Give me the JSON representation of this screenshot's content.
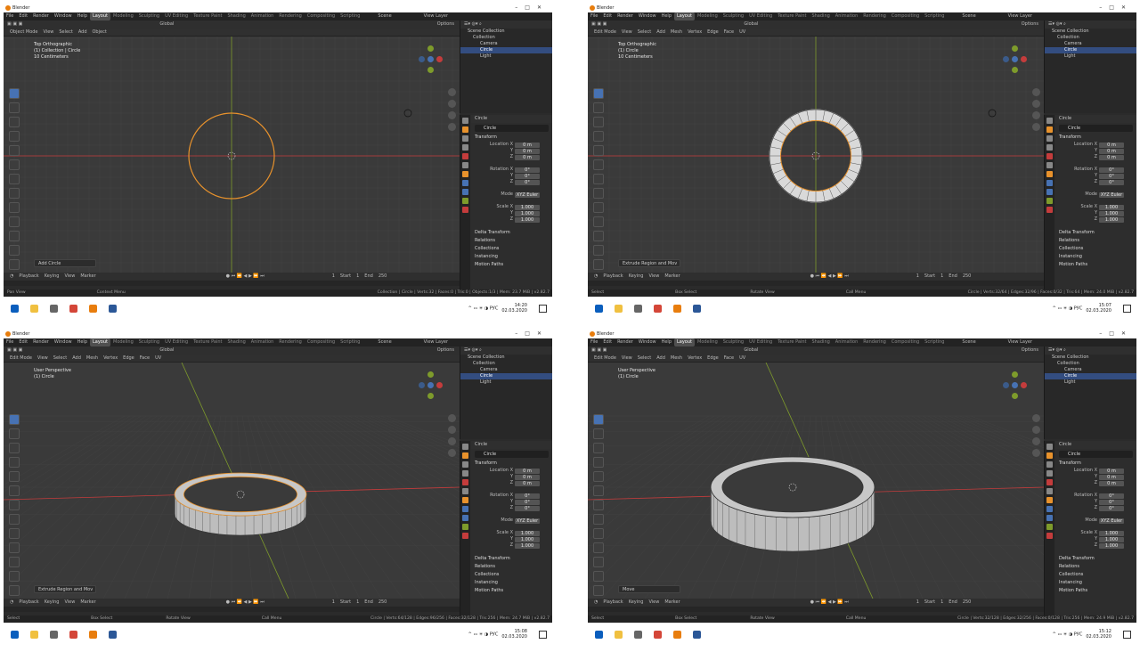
{
  "app": {
    "name": "Blender"
  },
  "menus": [
    "File",
    "Edit",
    "Render",
    "Window",
    "Help"
  ],
  "workspaces": [
    "Layout",
    "Modeling",
    "Sculpting",
    "UV Editing",
    "Texture Paint",
    "Shading",
    "Animation",
    "Rendering",
    "Compositing",
    "Scripting"
  ],
  "scene_label": "Scene",
  "view_layer_label": "View Layer",
  "orientation": "Global",
  "options_label": "Options",
  "view_menus": {
    "object_mode": [
      "Object Mode",
      "View",
      "Select",
      "Add",
      "Object"
    ],
    "edit_mode": [
      "Edit Mode",
      "View",
      "Select",
      "Add",
      "Mesh",
      "Vertex",
      "Edge",
      "Face",
      "UV"
    ]
  },
  "outliner": {
    "scene_collection": "Scene Collection",
    "collection": "Collection",
    "camera": "Camera",
    "circle": "Circle",
    "light": "Light"
  },
  "properties": {
    "object_name": "Circle",
    "section_transform": "Transform",
    "location_label": "Location X",
    "rotation_label": "Rotation X",
    "mode_label": "Mode",
    "mode_value": "XYZ Euler",
    "scale_label": "Scale X",
    "axis_y": "Y",
    "axis_z": "Z",
    "loc_values": [
      "0 m",
      "0 m",
      "0 m"
    ],
    "rot_values": [
      "0°",
      "0°",
      "0°"
    ],
    "scale_values": [
      "1.000",
      "1.000",
      "1.000"
    ],
    "delta_transform": "Delta Transform",
    "relations": "Relations",
    "collections": "Collections",
    "instancing": "Instancing",
    "motion_paths": "Motion Paths"
  },
  "timeline": {
    "playback": "Playback",
    "keying": "Keying",
    "view": "View",
    "marker": "Marker",
    "current_frame": "1",
    "start_label": "Start",
    "start": "1",
    "end_label": "End",
    "end": "250"
  },
  "taskbar": {
    "language": "РУС",
    "date": "02.03.2020"
  },
  "colors": {
    "accent": "#4772b3",
    "selection": "#334d80",
    "active_object": "#e8922c",
    "x_axis": "#c43c3c",
    "y_axis": "#7e9b2b",
    "blender_orange": "#e87d0d"
  },
  "screens": [
    {
      "mode": "object",
      "view_name": "Top Orthographic",
      "view_sub": "(1) Collection | Circle",
      "view_scale": "10 Centimeters",
      "last_op": "Add Circle",
      "status_left": [
        "Pan View",
        "Context Menu"
      ],
      "status_right": "Collection | Circle | Verts:32 | Faces:0 | Tris:0 | Objects:1/3 | Mem: 23.7 MiB | v2.82.7",
      "time": "14:20"
    },
    {
      "mode": "edit",
      "view_name": "Top Orthographic",
      "view_sub": "(1) Circle",
      "view_scale": "10 Centimeters",
      "last_op": "Extrude Region and Mov",
      "status_left": [
        "Select",
        "Box Select",
        "Rotate View",
        "Call Menu"
      ],
      "status_right": "Circle | Verts:32/64 | Edges:32/96 | Faces:0/32 | Tris:64 | Mem: 24.0 MiB | v2.82.7",
      "time": "15:07"
    },
    {
      "mode": "edit",
      "view_name": "User Perspective",
      "view_sub": "(1) Circle",
      "view_scale": "",
      "last_op": "Extrude Region and Mov",
      "status_left": [
        "Select",
        "Box Select",
        "Rotate View",
        "Call Menu"
      ],
      "status_right": "Circle | Verts:64/128 | Edges:96/256 | Faces:32/128 | Tris:256 | Mem: 24.7 MiB | v2.82.7",
      "time": "15:08"
    },
    {
      "mode": "edit",
      "view_name": "User Perspective",
      "view_sub": "(1) Circle",
      "view_scale": "",
      "last_op": "Move",
      "status_left": [
        "Select",
        "Box Select",
        "Rotate View",
        "Call Menu"
      ],
      "status_right": "Circle | Verts:32/128 | Edges:32/256 | Faces:0/128 | Tris:256 | Mem: 24.9 MiB | v2.82.7",
      "time": "15:12"
    }
  ]
}
